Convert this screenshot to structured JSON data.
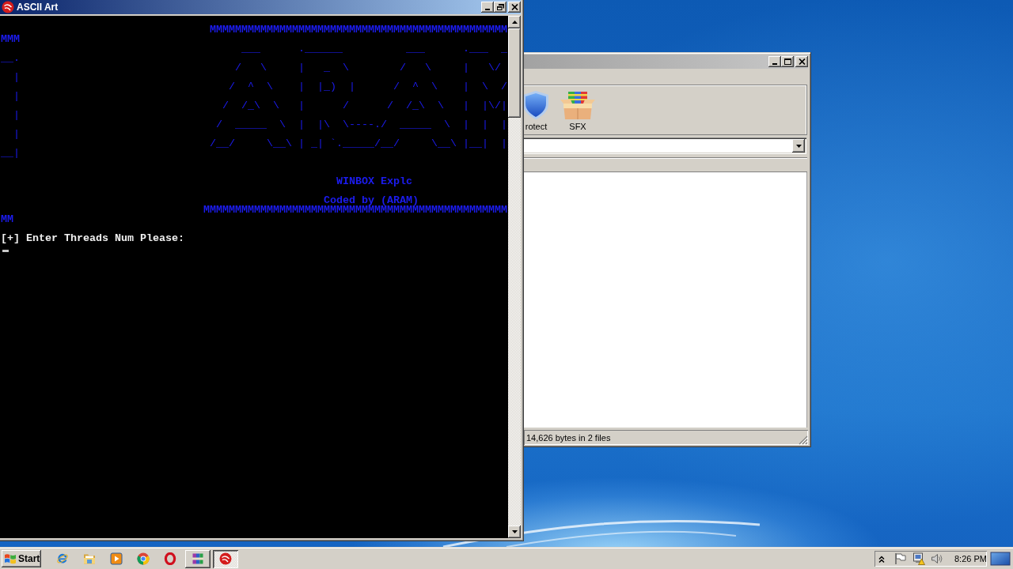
{
  "console_window": {
    "title": "ASCII Art",
    "active": true,
    "lines": [
      {
        "kind": "blank"
      },
      {
        "kind": "border",
        "text": "                                 MMMMMMMMMMMMMMMMMMMMMMMMMMMMMMMMMMMMMMMMMMMMMMM"
      },
      {
        "kind": "border",
        "text": "MMM"
      },
      {
        "kind": "art",
        "text": "                                      ___      .______          ___      .___  _"
      },
      {
        "kind": "art",
        "text": "__."
      },
      {
        "kind": "art",
        "text": "                                     /   \\     |   _  \\        /   \\     |   \\/"
      },
      {
        "kind": "art",
        "text": "  |"
      },
      {
        "kind": "art",
        "text": "                                    /  ^  \\    |  |_)  |      /  ^  \\    |  \\  /"
      },
      {
        "kind": "art",
        "text": "  |"
      },
      {
        "kind": "art",
        "text": "                                   /  /_\\  \\   |      /      /  /_\\  \\   |  |\\/|"
      },
      {
        "kind": "art",
        "text": "  |"
      },
      {
        "kind": "art",
        "text": "                                  /  _____  \\  |  |\\  \\----./  _____  \\  |  |  |"
      },
      {
        "kind": "art",
        "text": "  |"
      },
      {
        "kind": "art",
        "text": "                                 /__/     \\__\\ | _| `._____/__/     \\__\\ |__|  |"
      },
      {
        "kind": "art",
        "text": "__|"
      },
      {
        "kind": "blank"
      },
      {
        "kind": "blank"
      },
      {
        "kind": "text",
        "text": "                                                     WINBOX Explc"
      },
      {
        "kind": "blank"
      },
      {
        "kind": "text",
        "text": "                                                   Coded by (ARAM)"
      },
      {
        "kind": "border",
        "text": "                                MMMMMMMMMMMMMMMMMMMMMMMMMMMMMMMMMMMMMMMMMMMMMMMM"
      },
      {
        "kind": "border",
        "text": "MM"
      },
      {
        "kind": "blank"
      },
      {
        "kind": "prompt",
        "text": "[+] Enter Threads Num Please:"
      }
    ],
    "cursor_shown": true
  },
  "archive_window": {
    "active": false,
    "toolbar": [
      {
        "kind": "shield",
        "label": "rotect"
      },
      {
        "kind": "box",
        "label": "SFX"
      }
    ],
    "status_text": "14,626 bytes in 2 files"
  },
  "taskbar": {
    "start_label": "Start",
    "tasks": [
      {
        "kind": "books",
        "selected": false
      },
      {
        "kind": "disc",
        "selected": true
      }
    ],
    "clock": "8:26 PM"
  }
}
